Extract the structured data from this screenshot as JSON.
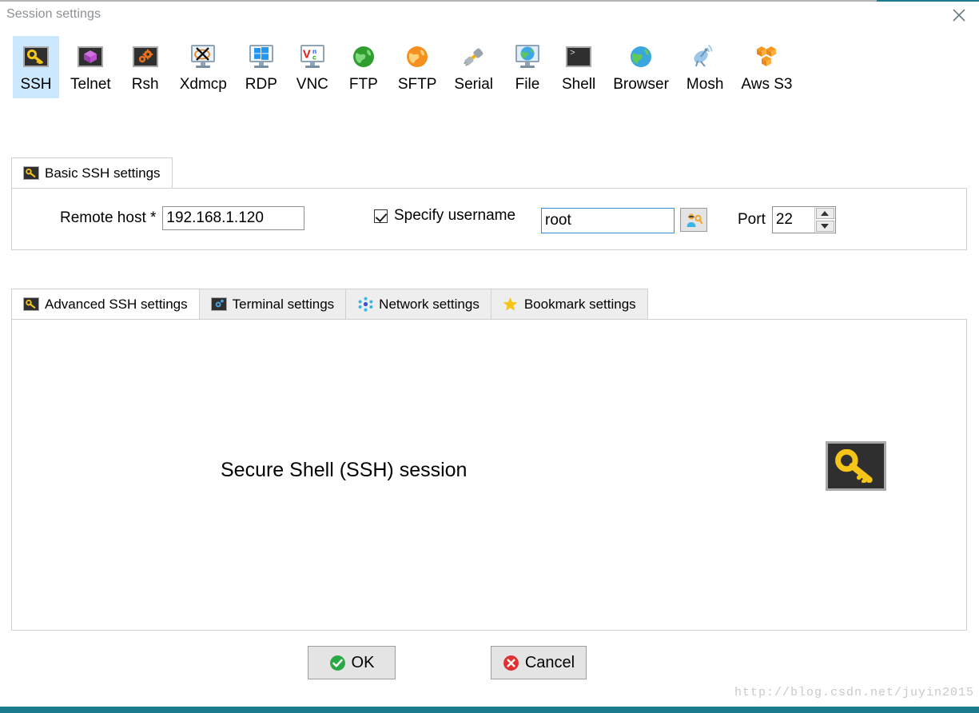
{
  "window": {
    "title": "Session settings",
    "close_icon": "close-icon",
    "accent_color": "#1c7b8c"
  },
  "protocols": {
    "selected": "SSH",
    "selected_bg": "#cce8ff",
    "items": [
      {
        "label": "SSH",
        "icon": "ssh-key-icon"
      },
      {
        "label": "Telnet",
        "icon": "telnet-cube-icon"
      },
      {
        "label": "Rsh",
        "icon": "rsh-gears-icon"
      },
      {
        "label": "Xdmcp",
        "icon": "xdmcp-monitor-icon"
      },
      {
        "label": "RDP",
        "icon": "rdp-windows-monitor-icon"
      },
      {
        "label": "VNC",
        "icon": "vnc-monitor-icon"
      },
      {
        "label": "FTP",
        "icon": "ftp-green-globe-icon"
      },
      {
        "label": "SFTP",
        "icon": "sftp-orange-globe-icon"
      },
      {
        "label": "Serial",
        "icon": "serial-plug-icon"
      },
      {
        "label": "File",
        "icon": "file-monitor-globe-icon"
      },
      {
        "label": "Shell",
        "icon": "shell-terminal-icon"
      },
      {
        "label": "Browser",
        "icon": "browser-globe-icon"
      },
      {
        "label": "Mosh",
        "icon": "mosh-satellite-icon"
      },
      {
        "label": "Aws S3",
        "icon": "aws-s3-cubes-icon"
      }
    ]
  },
  "basic": {
    "tab_label": "Basic SSH settings",
    "tab_icon": "key-icon",
    "remote_host_label": "Remote host *",
    "remote_host_value": "192.168.1.120",
    "specify_username_label": "Specify username",
    "specify_username_checked": true,
    "username_value": "root",
    "username_picker_icon": "user-key-icon",
    "port_label": "Port",
    "port_value": "22"
  },
  "settings_tabs": {
    "active": "Advanced SSH settings",
    "items": [
      {
        "label": "Advanced SSH settings",
        "icon": "key-icon"
      },
      {
        "label": "Terminal settings",
        "icon": "gear-icon"
      },
      {
        "label": "Network settings",
        "icon": "network-dots-icon"
      },
      {
        "label": "Bookmark settings",
        "icon": "star-icon"
      }
    ]
  },
  "content": {
    "description": "Secure Shell (SSH) session",
    "badge_icon": "ssh-key-icon"
  },
  "footer": {
    "ok_label": "OK",
    "ok_icon": "check-circle-icon",
    "cancel_label": "Cancel",
    "cancel_icon": "x-circle-icon"
  },
  "watermark": {
    "text": "http://blog.csdn.net/juyin2015"
  }
}
